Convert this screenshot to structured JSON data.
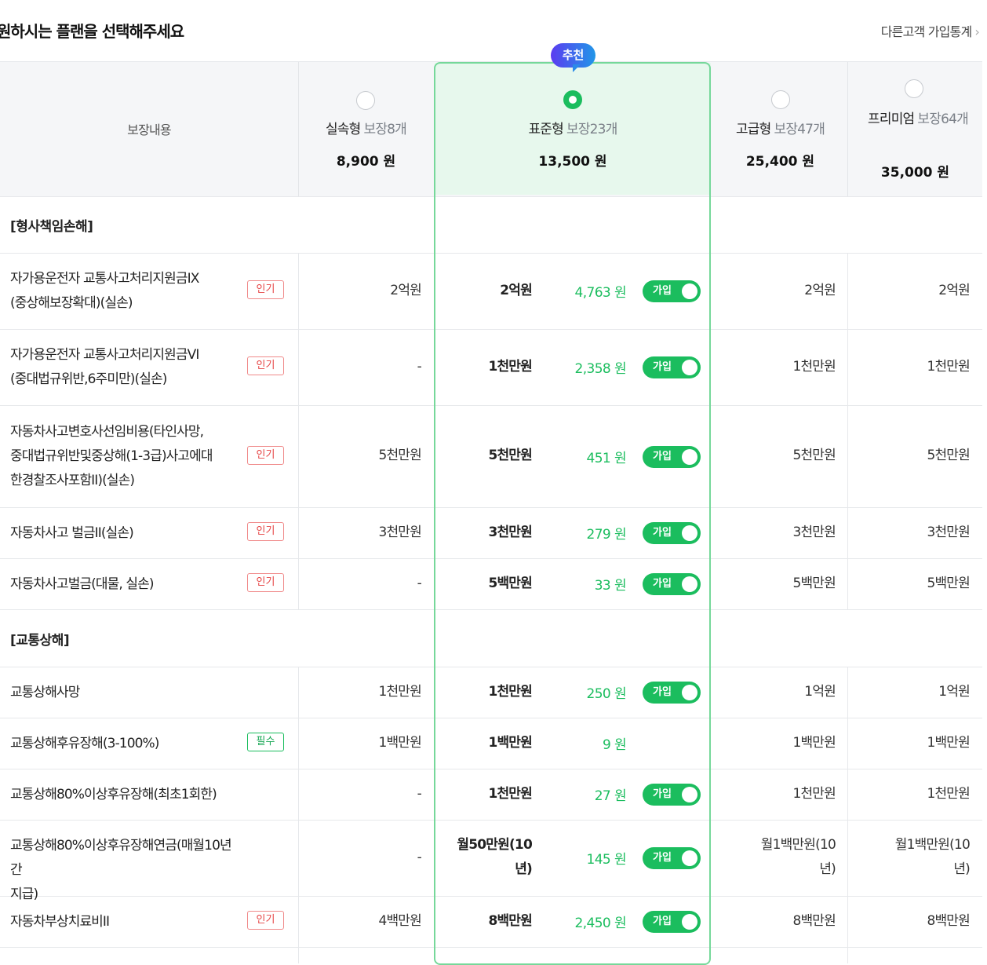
{
  "page_title": "원하시는 플랜을 선택해주세요",
  "stats_link": "다른고객 가입통계",
  "coverage_header": "보장내용",
  "recommend_badge": "추천",
  "plans": [
    {
      "name": "실속형",
      "count": "보장8개",
      "price": "8,900 원",
      "selected": false
    },
    {
      "name": "표준형",
      "count": "보장23개",
      "price": "13,500 원",
      "selected": true
    },
    {
      "name": "고급형",
      "count": "보장47개",
      "price": "25,400 원",
      "selected": false
    },
    {
      "name": "프리미엄",
      "count": "보장64개",
      "price": "35,000 원",
      "selected": false
    }
  ],
  "join_label": "가입",
  "sections": [
    {
      "title": "[형사책임손해]"
    },
    {
      "title": "[교통상해]"
    }
  ],
  "rows": [
    {
      "name": "자가용운전자 교통사고처리지원금IX(중상해보장확대)(실손)",
      "tag": "인기",
      "basic": "2억원",
      "std": "2억원",
      "premium": "4,763 원",
      "toggle": true,
      "adv": "2억원",
      "pre": "2억원"
    },
    {
      "name": "자가용운전자 교통사고처리지원금VI(중대법규위반,6주미만)(실손)",
      "tag": "인기",
      "basic": "-",
      "std": "1천만원",
      "premium": "2,358 원",
      "toggle": true,
      "adv": "1천만원",
      "pre": "1천만원"
    },
    {
      "name": "자동차사고변호사선임비용(타인사망,중대법규위반및중상해(1-3급)사고에대한경찰조사포함II)(실손)",
      "tag": "인기",
      "basic": "5천만원",
      "std": "5천만원",
      "premium": "451 원",
      "toggle": true,
      "adv": "5천만원",
      "pre": "5천만원"
    },
    {
      "name": "자동차사고 벌금II(실손)",
      "tag": "인기",
      "basic": "3천만원",
      "std": "3천만원",
      "premium": "279 원",
      "toggle": true,
      "adv": "3천만원",
      "pre": "3천만원"
    },
    {
      "name": "자동차사고벌금(대물, 실손)",
      "tag": "인기",
      "basic": "-",
      "std": "5백만원",
      "premium": "33 원",
      "toggle": true,
      "adv": "5백만원",
      "pre": "5백만원"
    },
    {
      "name": "교통상해사망",
      "tag": "",
      "basic": "1천만원",
      "std": "1천만원",
      "premium": "250 원",
      "toggle": true,
      "adv": "1억원",
      "pre": "1억원"
    },
    {
      "name": "교통상해후유장해(3-100%)",
      "tag": "필수",
      "basic": "1백만원",
      "std": "1백만원",
      "premium": "9 원",
      "toggle": false,
      "adv": "1백만원",
      "pre": "1백만원"
    },
    {
      "name": "교통상해80%이상후유장해(최초1회한)",
      "tag": "",
      "basic": "-",
      "std": "1천만원",
      "premium": "27 원",
      "toggle": true,
      "adv": "1천만원",
      "pre": "1천만원"
    },
    {
      "name": "교통상해80%이상후유장해연금(매월10년간지급)",
      "tag": "",
      "basic": "-",
      "std": "월50만원(10년)",
      "premium": "145 원",
      "toggle": true,
      "adv": "월1백만원(10년)",
      "pre": "월1백만원(10년)"
    },
    {
      "name": "자동차부상치료비II",
      "tag": "인기",
      "basic": "4백만원",
      "std": "8백만원",
      "premium": "2,450 원",
      "toggle": true,
      "adv": "8백만원",
      "pre": "8백만원"
    }
  ],
  "colors": {
    "accent": "#1bbd5e",
    "popular": "#e64545",
    "badge_start": "#5b3cf0",
    "badge_end": "#2196e8"
  }
}
